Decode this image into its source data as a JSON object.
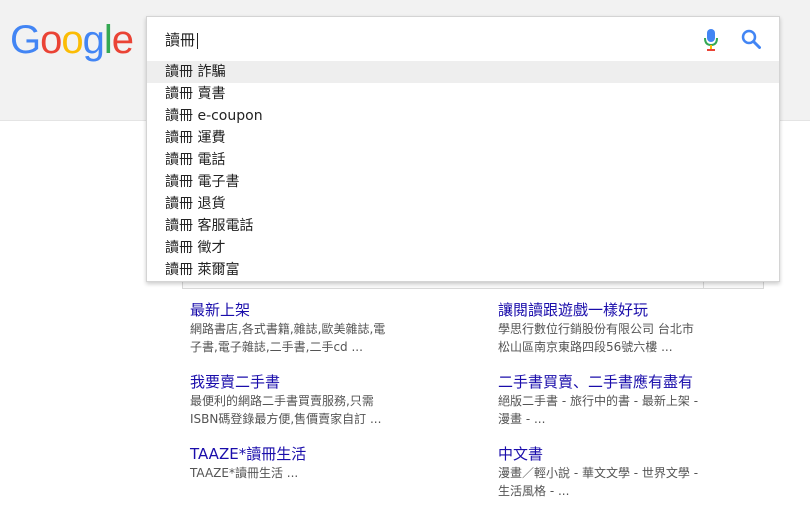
{
  "logo": {
    "text": "Google",
    "letters": [
      {
        "ch": "G",
        "color": "#4285F4"
      },
      {
        "ch": "o",
        "color": "#EA4335"
      },
      {
        "ch": "o",
        "color": "#FBBC05"
      },
      {
        "ch": "g",
        "color": "#4285F4"
      },
      {
        "ch": "l",
        "color": "#34A853"
      },
      {
        "ch": "e",
        "color": "#EA4335"
      }
    ]
  },
  "search": {
    "query": "讀冊"
  },
  "suggestions": [
    "讀冊 詐騙",
    "讀冊 賣書",
    "讀冊 e-coupon",
    "讀冊 運費",
    "讀冊 電話",
    "讀冊 電子書",
    "讀冊 退貨",
    "讀冊 客服電話",
    "讀冊 徵才",
    "讀冊 萊爾富"
  ],
  "sitelinks": [
    {
      "title": "最新上架",
      "desc1": "網路書店,各式書籍,雜誌,歐美雜誌,電",
      "desc2": "子書,電子雜誌,二手書,二手cd ..."
    },
    {
      "title": "讓閱讀跟遊戲一樣好玩",
      "desc1": "學思行數位行銷股份有限公司 台北市",
      "desc2": "松山區南京東路四段56號六樓 ..."
    },
    {
      "title": "我要賣二手書",
      "desc1": "最便利的網路二手書買賣服務,只需",
      "desc2": "ISBN碼登錄最方便,售價賣家自訂 ..."
    },
    {
      "title": "二手書買賣、二手書應有盡有",
      "desc1": "絕版二手書 - 旅行中的書 - 最新上架 -",
      "desc2": "漫畫 - ..."
    },
    {
      "title": "TAAZE*讀冊生活",
      "desc1": "TAAZE*讀冊生活 ...",
      "desc2": ""
    },
    {
      "title": "中文書",
      "desc1": "漫畫／輕小說 - 華文文學 - 世界文學 -",
      "desc2": "生活風格 - ..."
    }
  ],
  "colors": {
    "mic_blue": "#4285F4",
    "mic_red": "#EA4335",
    "search_blue": "#4285F4",
    "link": "#1a0dab"
  }
}
